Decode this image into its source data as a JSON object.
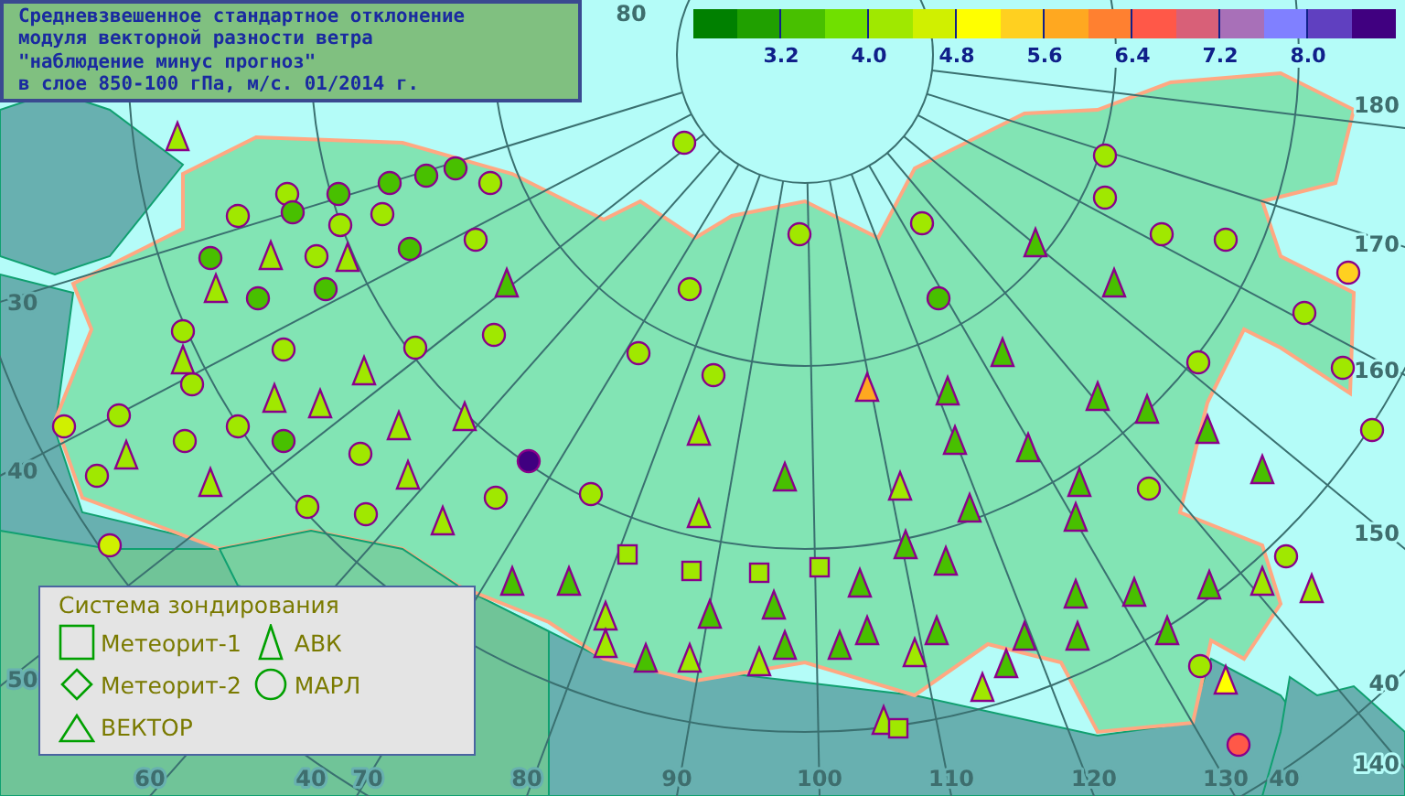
{
  "title": {
    "lines": [
      "Средневзвешенное стандартное отклонение",
      "модуля векторной разности ветра",
      "\"наблюдение минус прогноз\"",
      "в слое 850-100 гПа, м/с. 01/2014 г."
    ]
  },
  "color_scale": {
    "swatches": [
      {
        "color": "#008000"
      },
      {
        "color": "#20a000"
      },
      {
        "color": "#48c000"
      },
      {
        "color": "#70e000"
      },
      {
        "color": "#a0e800"
      },
      {
        "color": "#d0f000"
      },
      {
        "color": "#ffff00"
      },
      {
        "color": "#ffd020"
      },
      {
        "color": "#ffa820"
      },
      {
        "color": "#ff8030"
      },
      {
        "color": "#ff5848"
      },
      {
        "color": "#d86078"
      },
      {
        "color": "#a870b8"
      },
      {
        "color": "#8080ff"
      },
      {
        "color": "#6040c0"
      },
      {
        "color": "#400080"
      }
    ],
    "labels": [
      "3.2",
      "4.0",
      "4.8",
      "5.6",
      "6.4",
      "7.2",
      "8.0"
    ]
  },
  "map": {
    "grid_labels": [
      "80",
      "180",
      "30",
      "170",
      "160",
      "40",
      "150",
      "50",
      "40",
      "140",
      "60",
      "40",
      "70",
      "80",
      "90",
      "100",
      "110",
      "120",
      "130",
      "40"
    ],
    "stations": [
      {
        "kind": "circle",
        "color": "#a0e800"
      },
      {
        "kind": "circle",
        "color": "#48c000"
      },
      {
        "kind": "circle",
        "color": "#48c000"
      },
      {
        "kind": "circle",
        "color": "#48c000"
      },
      {
        "kind": "circle",
        "color": "#a0e800"
      },
      {
        "kind": "circle",
        "color": "#48c000"
      },
      {
        "kind": "circle",
        "color": "#a0e800"
      },
      {
        "kind": "circle",
        "color": "#a0e800"
      },
      {
        "kind": "circle",
        "color": "#48c000"
      },
      {
        "kind": "circle",
        "color": "#a0e800"
      },
      {
        "kind": "circle",
        "color": "#a0e800"
      },
      {
        "kind": "circle",
        "color": "#48c000"
      },
      {
        "kind": "circle",
        "color": "#48c000"
      },
      {
        "kind": "circle",
        "color": "#a0e800"
      },
      {
        "kind": "circle",
        "color": "#a0e800"
      },
      {
        "kind": "circle",
        "color": "#48c000"
      },
      {
        "kind": "circle",
        "color": "#48c000"
      },
      {
        "kind": "circle",
        "color": "#a0e800"
      },
      {
        "kind": "circle",
        "color": "#a0e800"
      },
      {
        "kind": "circle",
        "color": "#a0e800"
      },
      {
        "kind": "circle",
        "color": "#a0e800"
      },
      {
        "kind": "circle",
        "color": "#a0e800"
      },
      {
        "kind": "circle",
        "color": "#a0e800"
      },
      {
        "kind": "circle",
        "color": "#ffd020"
      },
      {
        "kind": "circle",
        "color": "#a0e800"
      },
      {
        "kind": "circle",
        "color": "#a0e800"
      },
      {
        "kind": "circle",
        "color": "#a0e800"
      },
      {
        "kind": "circle",
        "color": "#a0e800"
      },
      {
        "kind": "circle",
        "color": "#48c000"
      },
      {
        "kind": "circle",
        "color": "#a0e800"
      },
      {
        "kind": "circle",
        "color": "#a0e800"
      },
      {
        "kind": "circle",
        "color": "#a0e800"
      },
      {
        "kind": "circle",
        "color": "#a0e800"
      },
      {
        "kind": "circle",
        "color": "#a0e800"
      },
      {
        "kind": "circle",
        "color": "#a0e800"
      },
      {
        "kind": "circle",
        "color": "#a0e800"
      },
      {
        "kind": "circle",
        "color": "#d0f000"
      },
      {
        "kind": "circle",
        "color": "#a0e800"
      },
      {
        "kind": "circle",
        "color": "#a0e800"
      },
      {
        "kind": "circle",
        "color": "#a0e800"
      },
      {
        "kind": "circle",
        "color": "#a0e800"
      },
      {
        "kind": "circle",
        "color": "#d0f000"
      },
      {
        "kind": "circle",
        "color": "#a0e800"
      },
      {
        "kind": "circle",
        "color": "#48c000"
      },
      {
        "kind": "circle",
        "color": "#a0e800"
      },
      {
        "kind": "circle",
        "color": "#a0e800"
      },
      {
        "kind": "circle",
        "color": "#a0e800"
      },
      {
        "kind": "circle",
        "color": "#a0e800"
      },
      {
        "kind": "circle",
        "color": "#a0e800"
      },
      {
        "kind": "circle",
        "color": "#a0e800"
      },
      {
        "kind": "circle",
        "color": "#a0e800"
      },
      {
        "kind": "circle",
        "color": "#a0e800"
      },
      {
        "kind": "circle",
        "color": "#400080"
      },
      {
        "kind": "circle",
        "color": "#ff5848"
      },
      {
        "kind": "triangle",
        "color": "#a0e800"
      },
      {
        "kind": "triangle",
        "color": "#a0e800"
      },
      {
        "kind": "triangle",
        "color": "#a0e800"
      },
      {
        "kind": "triangle",
        "color": "#a0e800"
      },
      {
        "kind": "triangle",
        "color": "#a0e800"
      },
      {
        "kind": "triangle",
        "color": "#a0e800"
      },
      {
        "kind": "triangle",
        "color": "#a0e800"
      },
      {
        "kind": "triangle",
        "color": "#a0e800"
      },
      {
        "kind": "triangle",
        "color": "#a0e800"
      },
      {
        "kind": "triangle",
        "color": "#a0e800"
      },
      {
        "kind": "triangle",
        "color": "#a0e800"
      },
      {
        "kind": "triangle",
        "color": "#a0e800"
      },
      {
        "kind": "triangle",
        "color": "#a0e800"
      },
      {
        "kind": "triangle",
        "color": "#a0e800"
      },
      {
        "kind": "triangle",
        "color": "#a0e800"
      },
      {
        "kind": "triangle",
        "color": "#a0e800"
      },
      {
        "kind": "triangle",
        "color": "#a0e800"
      },
      {
        "kind": "triangle",
        "color": "#a0e800"
      },
      {
        "kind": "triangle",
        "color": "#a0e800"
      },
      {
        "kind": "triangle",
        "color": "#a0e800"
      },
      {
        "kind": "triangle",
        "color": "#a0e800"
      },
      {
        "kind": "triangle",
        "color": "#a0e800"
      },
      {
        "kind": "triangle",
        "color": "#a0e800"
      },
      {
        "kind": "triangle",
        "color": "#ffff00"
      },
      {
        "kind": "triangle",
        "color": "#a0e800"
      },
      {
        "kind": "triangle",
        "color": "#a0e800"
      },
      {
        "kind": "triangle",
        "color": "#ffa820"
      },
      {
        "kind": "triangle",
        "color": "#48c000"
      },
      {
        "kind": "triangle",
        "color": "#48c000"
      },
      {
        "kind": "triangle",
        "color": "#48c000"
      },
      {
        "kind": "triangle",
        "color": "#48c000"
      },
      {
        "kind": "triangle",
        "color": "#48c000"
      },
      {
        "kind": "triangle",
        "color": "#48c000"
      },
      {
        "kind": "triangle",
        "color": "#48c000"
      },
      {
        "kind": "triangle",
        "color": "#48c000"
      },
      {
        "kind": "triangle",
        "color": "#48c000"
      },
      {
        "kind": "triangle",
        "color": "#48c000"
      },
      {
        "kind": "triangle",
        "color": "#48c000"
      },
      {
        "kind": "triangle",
        "color": "#48c000"
      },
      {
        "kind": "triangle",
        "color": "#48c000"
      },
      {
        "kind": "triangle",
        "color": "#48c000"
      },
      {
        "kind": "triangle",
        "color": "#48c000"
      },
      {
        "kind": "triangle",
        "color": "#48c000"
      },
      {
        "kind": "triangle",
        "color": "#48c000"
      },
      {
        "kind": "triangle",
        "color": "#48c000"
      },
      {
        "kind": "triangle",
        "color": "#48c000"
      },
      {
        "kind": "triangle",
        "color": "#48c000"
      },
      {
        "kind": "triangle",
        "color": "#48c000"
      },
      {
        "kind": "triangle",
        "color": "#48c000"
      },
      {
        "kind": "triangle",
        "color": "#48c000"
      },
      {
        "kind": "triangle",
        "color": "#48c000"
      },
      {
        "kind": "triangle",
        "color": "#48c000"
      },
      {
        "kind": "triangle",
        "color": "#48c000"
      },
      {
        "kind": "triangle",
        "color": "#48c000"
      },
      {
        "kind": "triangle",
        "color": "#48c000"
      },
      {
        "kind": "triangle",
        "color": "#48c000"
      },
      {
        "kind": "triangle",
        "color": "#48c000"
      },
      {
        "kind": "triangle",
        "color": "#48c000"
      },
      {
        "kind": "triangle",
        "color": "#48c000"
      },
      {
        "kind": "triangle",
        "color": "#48c000"
      },
      {
        "kind": "triangle",
        "color": "#a0e800"
      },
      {
        "kind": "triangle",
        "color": "#48c000"
      },
      {
        "kind": "square",
        "color": "#a0e800"
      },
      {
        "kind": "square",
        "color": "#a0e800"
      },
      {
        "kind": "square",
        "color": "#a0e800"
      },
      {
        "kind": "square",
        "color": "#a0e800"
      },
      {
        "kind": "square",
        "color": "#a0e800"
      }
    ]
  },
  "legend": {
    "title": "Система зондирования",
    "items": [
      {
        "kind": "square",
        "label": "Метеорит-1"
      },
      {
        "kind": "tall-triangle",
        "label": "АВК"
      },
      {
        "kind": "diamond",
        "label": "Метеорит-2"
      },
      {
        "kind": "circle",
        "label": "МАРЛ"
      },
      {
        "kind": "triangle",
        "label": "ВЕКТОР"
      }
    ]
  }
}
